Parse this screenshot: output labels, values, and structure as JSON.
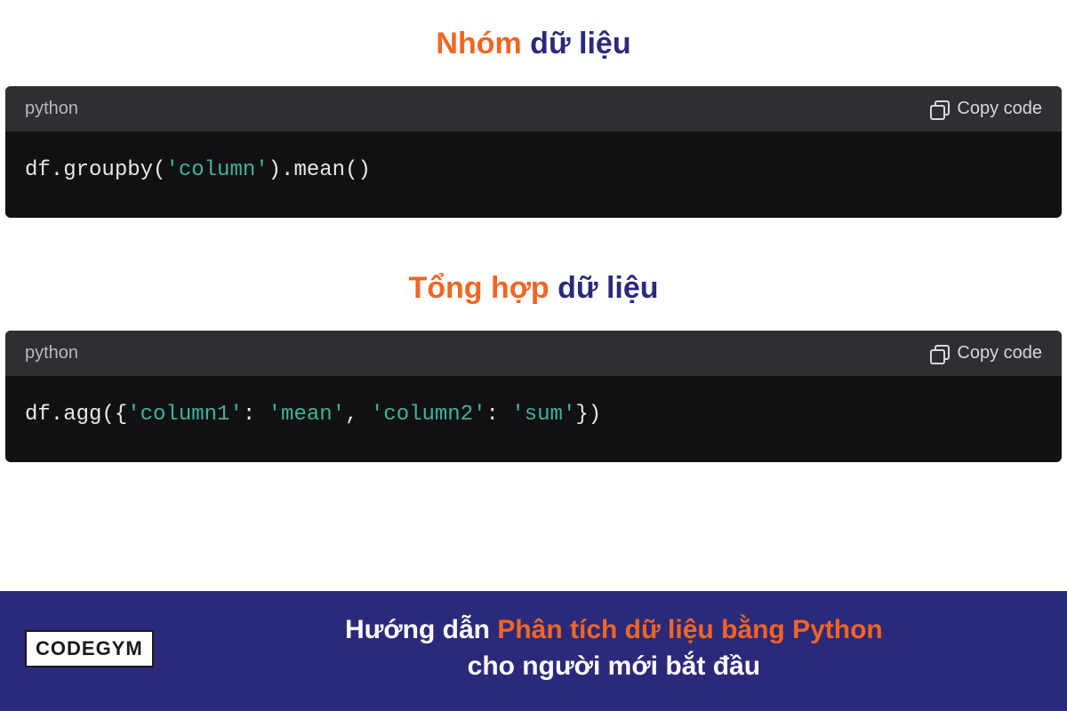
{
  "sections": [
    {
      "title_orange": "Nhóm",
      "title_navy": " dữ liệu",
      "lang": "python",
      "copy": "Copy code",
      "code_plain_1": "df.groupby(",
      "code_str_1": "'column'",
      "code_plain_2": ").mean()"
    },
    {
      "title_orange": "Tổng hợp",
      "title_navy": " dữ liệu",
      "lang": "python",
      "copy": "Copy code",
      "code_plain_1": "df.agg({",
      "code_str_1": "'column1'",
      "code_plain_2": ": ",
      "code_str_2": "'mean'",
      "code_plain_3": ", ",
      "code_str_3": "'column2'",
      "code_plain_4": ": ",
      "code_str_4": "'sum'",
      "code_plain_5": "})"
    }
  ],
  "footer": {
    "logo_code": "CODE",
    "logo_gym": "GYM",
    "line1_white": "Hướng dẫn ",
    "line1_orange": "Phân tích dữ liệu bằng Python",
    "line2_white": "cho người mới bắt đầu"
  }
}
